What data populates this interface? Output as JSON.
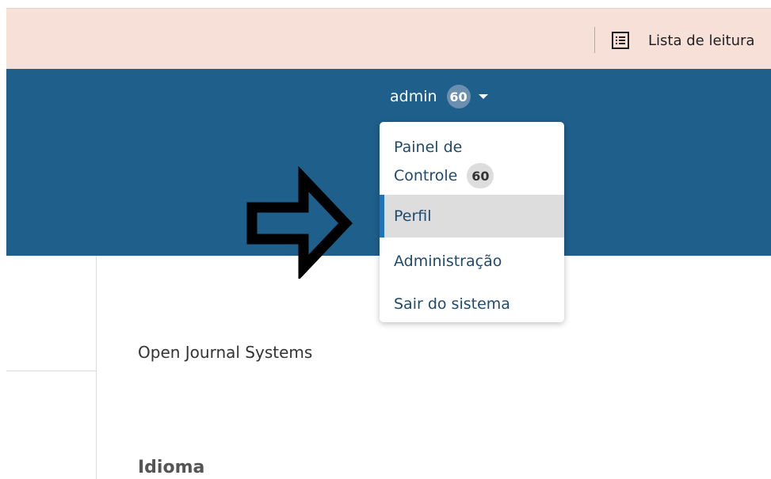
{
  "browser": {
    "reading_list_label": "Lista de leitura",
    "reading_list_icon": "reading-list-icon"
  },
  "header": {
    "user_name": "admin",
    "notification_count": "60",
    "background_color": "#1e5f8c"
  },
  "user_menu": {
    "items": [
      {
        "label_line1": "Painel de",
        "label_line2": "Controle",
        "badge": "60"
      },
      {
        "label": "Perfil",
        "highlighted": true
      },
      {
        "label": "Administração"
      },
      {
        "label": "Sair do sistema"
      }
    ],
    "highlight_color": "#dddddd",
    "accent_color": "#1e73be"
  },
  "content": {
    "site_name": "Open Journal Systems",
    "language_heading": "Idioma"
  },
  "annotation": {
    "arrow_icon": "right-arrow-icon"
  }
}
